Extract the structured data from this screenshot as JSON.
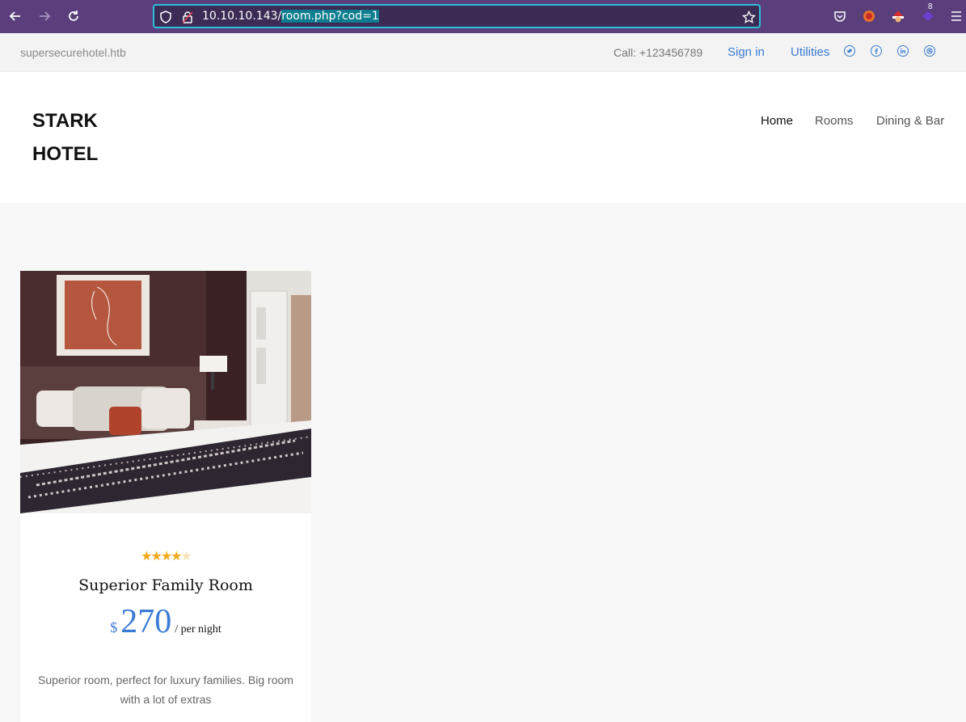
{
  "browser": {
    "url_host": "10.10.10.143/",
    "url_path": "room.php?cod=1",
    "badge_count": "8"
  },
  "topbar": {
    "domain": "supersecurehotel.htb",
    "call": "Call: +123456789",
    "sign_in": "Sign in",
    "utilities": "Utilities",
    "social_icons": [
      "twitter-icon",
      "facebook-icon",
      "linkedin-icon",
      "dribbble-icon"
    ]
  },
  "header": {
    "logo_line1": "STARK",
    "logo_line2": "HOTEL",
    "nav": [
      "Home",
      "Rooms",
      "Dining & Bar"
    ]
  },
  "room": {
    "rating": 4,
    "rating_max": 5,
    "title": "Superior Family Room",
    "currency": "$",
    "price": "270",
    "per": "/ per night",
    "description": "Superior room, perfect for luxury families. Big room with a lot of extras"
  },
  "colors": {
    "accent": "#3a7bd5",
    "star": "#f2a91b",
    "browser_bg": "#5b3f7d"
  }
}
